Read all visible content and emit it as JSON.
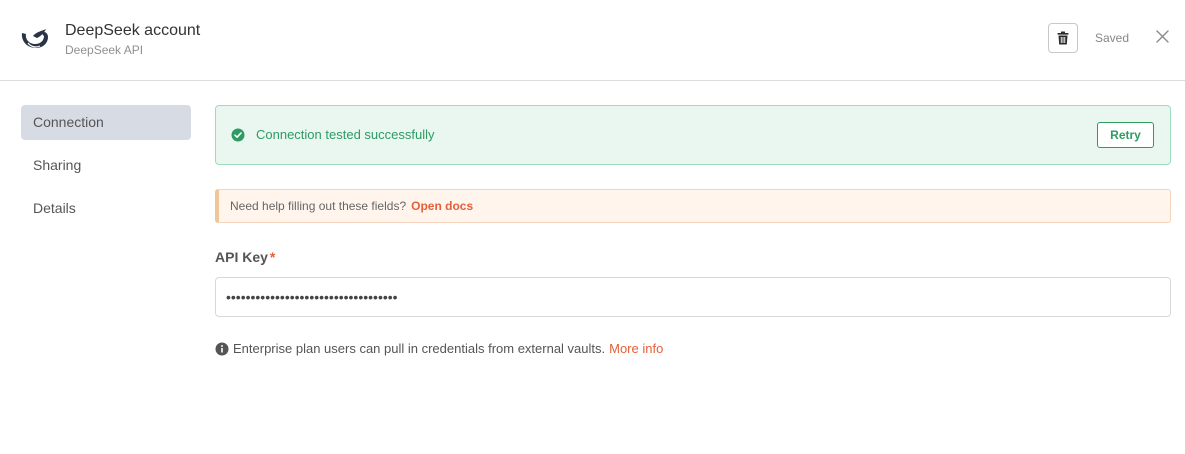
{
  "header": {
    "title": "DeepSeek account",
    "subtitle": "DeepSeek API",
    "status": "Saved",
    "logo_icon": "deepseek-whale-icon",
    "delete_icon": "trash-icon",
    "close_icon": "close-icon"
  },
  "sidebar": {
    "items": [
      {
        "label": "Connection",
        "active": true
      },
      {
        "label": "Sharing",
        "active": false
      },
      {
        "label": "Details",
        "active": false
      }
    ]
  },
  "alert": {
    "message": "Connection tested successfully",
    "retry_label": "Retry",
    "icon": "check-circle-icon"
  },
  "hint": {
    "text": "Need help filling out these fields?",
    "link": "Open docs"
  },
  "api_key": {
    "label": "API Key",
    "required_marker": "*",
    "value": "•••••••••••••••••••••••••••••••••••"
  },
  "info": {
    "text": "Enterprise plan users can pull in credentials from external vaults.",
    "link": "More info",
    "icon": "info-icon"
  },
  "colors": {
    "accent": "#e4603c",
    "success": "#2e9b62",
    "success_bg": "#e9f7f0",
    "hint_bg": "#fff5ed",
    "active_nav_bg": "#d7dbe4"
  }
}
